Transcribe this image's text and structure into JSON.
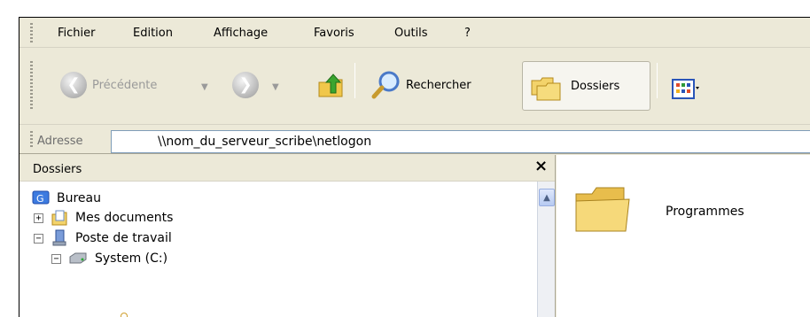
{
  "menu": {
    "items": [
      "Fichier",
      "Edition",
      "Affichage",
      "Favoris",
      "Outils",
      "?"
    ]
  },
  "toolbar": {
    "back_label": "Précédente",
    "search_label": "Rechercher",
    "folders_label": "Dossiers",
    "back_icon": "back-arrow-icon",
    "forward_icon": "forward-arrow-icon",
    "up_icon": "folder-up-icon",
    "search_icon": "magnifier-icon",
    "folders_icon": "folders-icon",
    "views_icon": "views-icon"
  },
  "address": {
    "label": "Adresse",
    "value": "\\\\nom_du_serveur_scribe\\netlogon"
  },
  "folders_pane": {
    "title": "Dossiers",
    "close": "×",
    "tree": [
      {
        "label": "Bureau",
        "icon": "desktop-icon",
        "expander": ""
      },
      {
        "label": "Mes documents",
        "icon": "my-documents-icon",
        "expander": "+"
      },
      {
        "label": "Poste de travail",
        "icon": "my-computer-icon",
        "expander": "−"
      },
      {
        "label": "System (C:)",
        "icon": "drive-icon",
        "expander": "−"
      }
    ]
  },
  "content": {
    "items": [
      {
        "label": "Programmes",
        "icon": "folder-icon"
      }
    ]
  },
  "colors": {
    "chrome": "#ece9d8",
    "forward_green": "#2f9d26",
    "folder_yellow": "#f3d36b",
    "scroll_blue": "#b7cbf2"
  }
}
